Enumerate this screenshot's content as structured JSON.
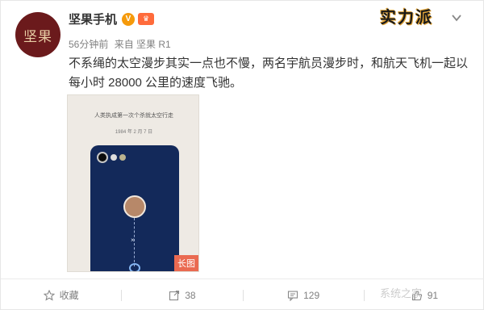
{
  "author": {
    "avatar_text": "坚果",
    "name": "坚果手机",
    "verified_mark": "V",
    "vip_badge": "♛"
  },
  "meta": {
    "time": "56分钟前",
    "source": "来自 坚果 R1"
  },
  "brand_logo": "实力派",
  "post": {
    "text": "不系绳的太空漫步其实一点也不慢，两名宇航员漫步时，和航天飞机一起以每小时 28000 公里的速度飞驰。"
  },
  "image": {
    "headline": "人类执成第一次个杀就太空行走",
    "date": "1984 年 2 月 7 日",
    "cross_glyph": "×",
    "badge": "长图"
  },
  "actions": {
    "favorite_label": "收藏",
    "repost_count": "38",
    "comment_count": "129",
    "like_count": "91"
  },
  "watermark": "系统之家",
  "colors": {
    "avatar_bg": "#6b1a1c",
    "phone_bg": "#13295a",
    "badge_bg": "#ea6a51",
    "verified_bg": "#f59a0b"
  }
}
